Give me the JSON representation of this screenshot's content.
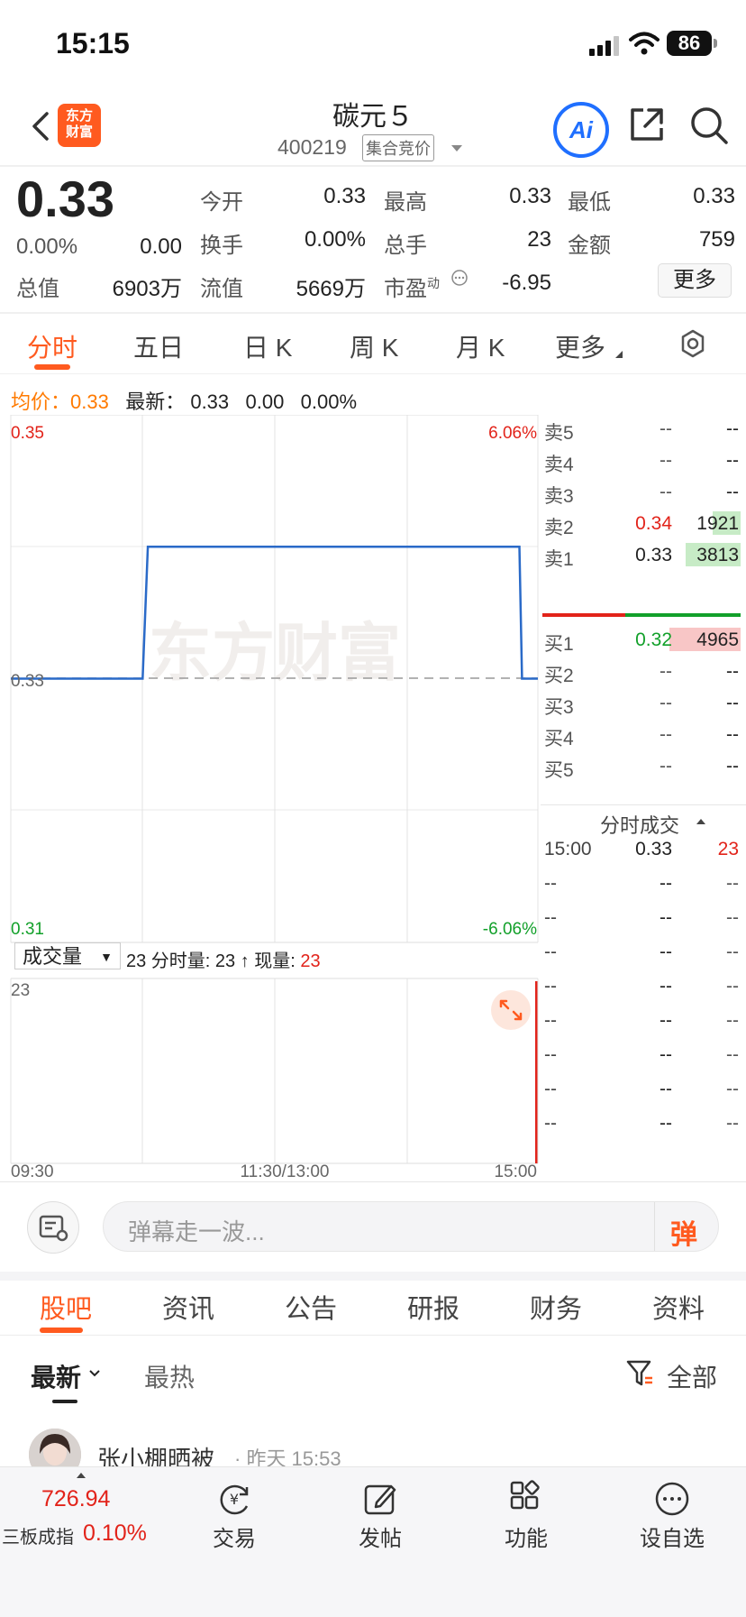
{
  "status_bar": {
    "time": "15:15",
    "battery": "86"
  },
  "header": {
    "stock_name": "碳元５",
    "stock_code": "400219",
    "auction_tag": "集合竞价",
    "logo_text_line1": "东方",
    "logo_text_line2": "财富",
    "ai_label": "Ai"
  },
  "quote": {
    "price": "0.33",
    "change_pct": "0.00%",
    "change": "0.00",
    "total_value_label": "总值",
    "total_value": "6903万",
    "open_label": "今开",
    "open": "0.33",
    "high_label": "最高",
    "high": "0.33",
    "low_label": "最低",
    "low": "0.33",
    "turnover_label": "换手",
    "turnover": "0.00%",
    "total_hands_label": "总手",
    "total_hands": "23",
    "amount_label": "金额",
    "amount": "759",
    "float_value_label": "流值",
    "float_value": "5669万",
    "pe_label": "市盈",
    "pe_sup": "动",
    "pe": "-6.95",
    "more_button": "更多"
  },
  "chart_tabs": [
    "分时",
    "五日",
    "日 K",
    "周 K",
    "月 K",
    "更多"
  ],
  "avg_row": {
    "avg_label": "均价：",
    "avg": "0.33",
    "latest_label": "最新：",
    "latest": "0.33",
    "chg": "0.00",
    "chg_pct": "0.00%"
  },
  "chart_data": {
    "type": "line",
    "watermark": "东方财富",
    "y_top_label": "0.35",
    "y_mid_label": "0.33",
    "y_bottom_label": "0.31",
    "pct_top_label": "6.06%",
    "pct_bottom_label": "-6.06%",
    "ylim": [
      0.31,
      0.35
    ],
    "prev_close": 0.33,
    "x_labels": [
      "09:30",
      "11:30/13:00",
      "15:00"
    ],
    "series": [
      {
        "x": [
          0,
          0.25,
          0.26,
          0.965,
          0.97,
          1.0
        ],
        "values": [
          0.33,
          0.33,
          0.34,
          0.34,
          0.33,
          0.33
        ]
      }
    ],
    "volume": {
      "max_label": "23",
      "bars": [
        {
          "x": 1.0,
          "value": 23
        }
      ]
    }
  },
  "volume_header": {
    "dropdown": "成交量",
    "info_prefix": "23 分时量: 23 ↑ 现量: ",
    "current": "23"
  },
  "order_book": {
    "asks": [
      {
        "label": "卖5",
        "price": "--",
        "vol": "--"
      },
      {
        "label": "卖4",
        "price": "--",
        "vol": "--"
      },
      {
        "label": "卖3",
        "price": "--",
        "vol": "--"
      },
      {
        "label": "卖2",
        "price": "0.34",
        "vol": "1921"
      },
      {
        "label": "卖1",
        "price": "0.33",
        "vol": "3813"
      }
    ],
    "bids": [
      {
        "label": "买1",
        "price": "0.32",
        "vol": "4965"
      },
      {
        "label": "买2",
        "price": "--",
        "vol": "--"
      },
      {
        "label": "买3",
        "price": "--",
        "vol": "--"
      },
      {
        "label": "买4",
        "price": "--",
        "vol": "--"
      },
      {
        "label": "买5",
        "price": "--",
        "vol": "--"
      }
    ],
    "trades_title": "分时成交",
    "trades": [
      {
        "time": "15:00",
        "price": "0.33",
        "vol": "23"
      },
      {
        "time": "--",
        "price": "--",
        "vol": "--"
      },
      {
        "time": "--",
        "price": "--",
        "vol": "--"
      },
      {
        "time": "--",
        "price": "--",
        "vol": "--"
      },
      {
        "time": "--",
        "price": "--",
        "vol": "--"
      },
      {
        "time": "--",
        "price": "--",
        "vol": "--"
      },
      {
        "time": "--",
        "price": "--",
        "vol": "--"
      },
      {
        "time": "--",
        "price": "--",
        "vol": "--"
      },
      {
        "time": "--",
        "price": "--",
        "vol": "--"
      }
    ]
  },
  "danmaku": {
    "placeholder": "弹幕走一波...",
    "send": "弹"
  },
  "bottom_tabs": [
    "股吧",
    "资讯",
    "公告",
    "研报",
    "财务",
    "资料"
  ],
  "sort": {
    "newest": "最新",
    "hot": "最热",
    "filter": "全部"
  },
  "post": {
    "user": "张小棚晒被",
    "time": "· 昨天 15:53"
  },
  "index_ticker": {
    "value": "726.94",
    "name": "三板成指",
    "pct": "0.10%"
  },
  "nav": [
    "交易",
    "发帖",
    "功能",
    "设自选"
  ],
  "colors": {
    "accent": "#ff5a1f",
    "up": "#e2231a",
    "down": "#12a02a",
    "line": "#2a6ac8"
  }
}
